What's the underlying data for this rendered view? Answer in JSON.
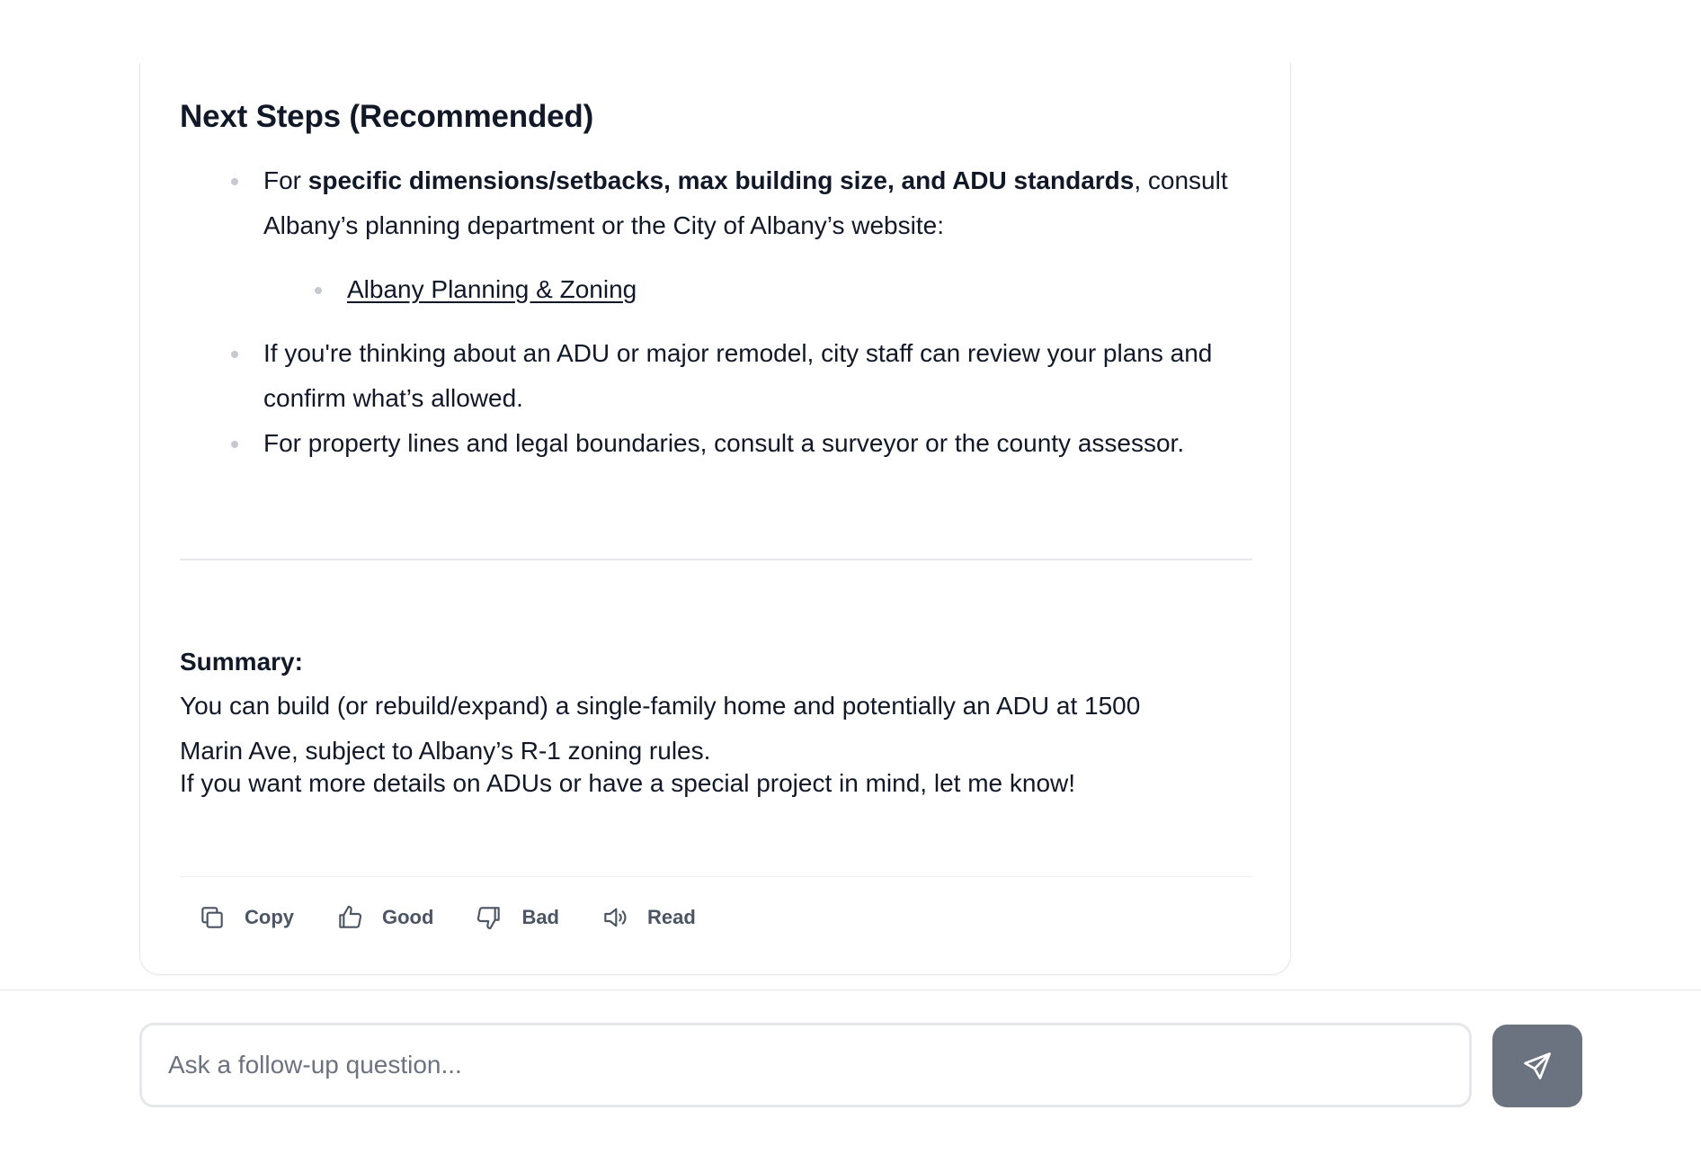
{
  "response": {
    "heading": "Next Steps (Recommended)",
    "steps": [
      {
        "pre": "For ",
        "bold": "specific dimensions/setbacks, max building size, and ADU standards",
        "post": ", consult Albany’s planning department or the City of Albany’s website:"
      },
      {
        "text": "If you're thinking about an ADU or major remodel, city staff can review your plans and confirm what’s allowed."
      },
      {
        "text": "For property lines and legal boundaries, consult a surveyor or the county assessor."
      }
    ],
    "link_label": "Albany Planning & Zoning",
    "summary_title": "Summary:",
    "summary_text": "You can build (or rebuild/expand) a single-family home and potentially an ADU at 1500 Marin Ave, subject to Albany’s R-1 zoning rules.",
    "closing": "If you want more details on ADUs or have a special project in mind, let me know!"
  },
  "actions": {
    "copy": "Copy",
    "good": "Good",
    "bad": "Bad",
    "read": "Read"
  },
  "composer": {
    "placeholder": "Ask a follow-up question..."
  },
  "icons": {
    "copy": "copy-icon",
    "good": "thumbs-up-icon",
    "bad": "thumbs-down-icon",
    "read": "speaker-icon",
    "send": "send-icon"
  },
  "colors": {
    "send_button": "#6b7280",
    "text": "#111827",
    "muted": "#4b5563"
  }
}
